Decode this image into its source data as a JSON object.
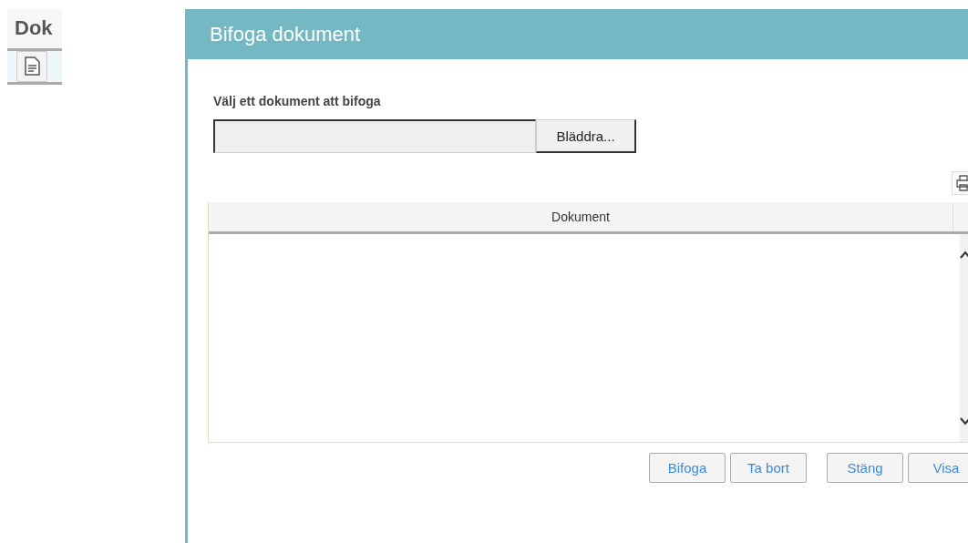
{
  "side_panel": {
    "title": "Dok"
  },
  "dialog": {
    "title": "Bifoga dokument",
    "file_label": "Välj ett dokument att bifoga",
    "browse_button": "Bläddra...",
    "table": {
      "columns": [
        "Dokument"
      ]
    },
    "button_groups": [
      [
        "Bifoga",
        "Ta bort"
      ],
      [
        "Stäng",
        "Visa"
      ]
    ]
  }
}
